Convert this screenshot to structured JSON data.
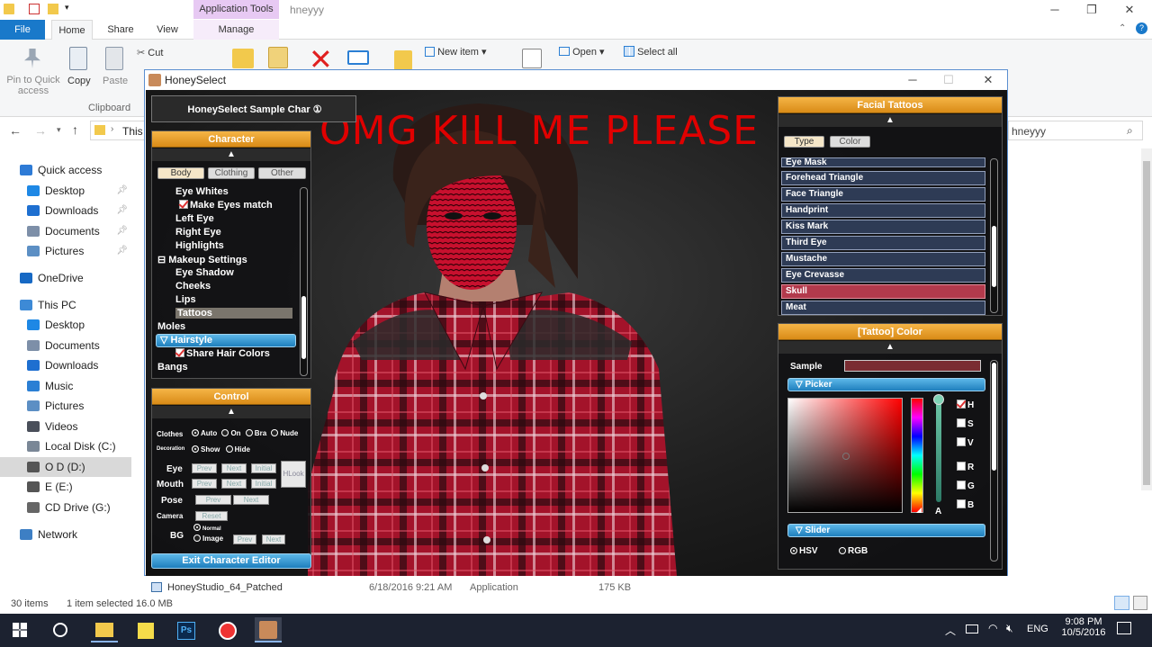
{
  "explorer": {
    "window_title": "hneyyy",
    "context_tab_group": "Application Tools",
    "tabs": [
      "File",
      "Home",
      "Share",
      "View",
      "Manage"
    ],
    "ribbon": {
      "pin_label": "Pin to Quick access",
      "copy_label": "Copy",
      "paste_label": "Paste",
      "cut_label": "Cut",
      "new_item_label": "New item",
      "open_label": "Open",
      "select_all_label": "Select all",
      "clipboard_group": "Clipboard"
    },
    "address_partial": "This",
    "search_value": "hneyyy",
    "nav": [
      {
        "label": "Quick access",
        "level": 0,
        "color": "#2e7bd6"
      },
      {
        "label": "Desktop",
        "level": 1,
        "pinned": true,
        "color": "#1e88e5"
      },
      {
        "label": "Downloads",
        "level": 1,
        "pinned": true,
        "color": "#1e6fd0"
      },
      {
        "label": "Documents",
        "level": 1,
        "pinned": true,
        "color": "#7d8fa8"
      },
      {
        "label": "Pictures",
        "level": 1,
        "pinned": true,
        "color": "#5c8fc4"
      },
      {
        "label": "OneDrive",
        "level": 0,
        "color": "#1769c4"
      },
      {
        "label": "This PC",
        "level": 0,
        "color": "#3d8ad6"
      },
      {
        "label": "Desktop",
        "level": 1,
        "color": "#1e88e5"
      },
      {
        "label": "Documents",
        "level": 1,
        "color": "#7d8fa8"
      },
      {
        "label": "Downloads",
        "level": 1,
        "color": "#1e6fd0"
      },
      {
        "label": "Music",
        "level": 1,
        "color": "#2b7fd4"
      },
      {
        "label": "Pictures",
        "level": 1,
        "color": "#5c8fc4"
      },
      {
        "label": "Videos",
        "level": 1,
        "color": "#4a4f5a"
      },
      {
        "label": "Local Disk (C:)",
        "level": 1,
        "color": "#7a8796"
      },
      {
        "label": "O D (D:)",
        "level": 1,
        "selected": true,
        "color": "#555"
      },
      {
        "label": "E (E:)",
        "level": 1,
        "color": "#555"
      },
      {
        "label": "CD Drive (G:)",
        "level": 1,
        "color": "#666"
      },
      {
        "label": "Network",
        "level": 0,
        "color": "#3d7fc4"
      }
    ],
    "file_row": {
      "name": "HoneyStudio_64_Patched",
      "date": "6/18/2016 9:21 AM",
      "type": "Application",
      "size": "175 KB"
    },
    "status": {
      "items": "30 items",
      "selected": "1 item selected 16.0 MB"
    }
  },
  "game": {
    "title": "HoneySelect",
    "headline": "OMG KILL ME PLEASE",
    "sample_char": "HoneySelect Sample Char ①",
    "character": {
      "title": "Character",
      "tabs": [
        "Body",
        "Clothing",
        "Other"
      ],
      "tree": [
        {
          "label": "Eye Whites",
          "indent": 2
        },
        {
          "label": "Make Eyes match",
          "indent": 3,
          "checkbox": true
        },
        {
          "label": "Left Eye",
          "indent": 2
        },
        {
          "label": "Right Eye",
          "indent": 2
        },
        {
          "label": "Highlights",
          "indent": 2
        },
        {
          "label": "Makeup Settings",
          "indent": 1,
          "collapse": true
        },
        {
          "label": "Eye Shadow",
          "indent": 2
        },
        {
          "label": "Cheeks",
          "indent": 2
        },
        {
          "label": "Lips",
          "indent": 2
        },
        {
          "label": "Tattoos",
          "indent": 2,
          "selected": true
        },
        {
          "label": "Moles",
          "indent": 1
        },
        {
          "label": "Hairstyle",
          "indent": 1,
          "expanded": true
        },
        {
          "label": "Share Hair Colors",
          "indent": 2,
          "checkbox": true
        },
        {
          "label": "Bangs",
          "indent": 1
        }
      ]
    },
    "control": {
      "title": "Control",
      "clothes_label": "Clothes",
      "clothes_opts": [
        "Auto",
        "On",
        "Bra",
        "Nude"
      ],
      "decoration_label": "Decoration",
      "decoration_opts": [
        "Show",
        "Hide"
      ],
      "eye_label": "Eye",
      "mouth_label": "Mouth",
      "prev": "Prev",
      "next": "Next",
      "initial": "Initial",
      "hlook": "HLook",
      "pose_label": "Pose",
      "camera_label": "Camera",
      "reset": "Reset",
      "bg_label": "BG",
      "bg_opts": [
        "Normal",
        "Image"
      ],
      "exit": "Exit Character Editor"
    },
    "tattoos": {
      "title": "Facial Tattoos",
      "tabs": [
        "Type",
        "Color"
      ],
      "items": [
        "Eye Mask",
        "Forehead Triangle",
        "Face Triangle",
        "Handprint",
        "Kiss Mark",
        "Third Eye",
        "Mustache",
        "Eye Crevasse",
        "Skull",
        "Meat"
      ],
      "selected": "Skull"
    },
    "tattoo_color": {
      "title": "[Tattoo] Color",
      "sample_label": "Sample",
      "sample_color": "#7a2d32",
      "picker_label": "Picker",
      "channels": [
        "H",
        "S",
        "V",
        "R",
        "G",
        "B"
      ],
      "checked_channel": "H",
      "slider_label": "Slider",
      "modes": [
        "HSV",
        "RGB"
      ],
      "alpha_label": "A"
    }
  },
  "taskbar": {
    "time": "9:08 PM",
    "date": "10/5/2016",
    "lang": "ENG"
  }
}
